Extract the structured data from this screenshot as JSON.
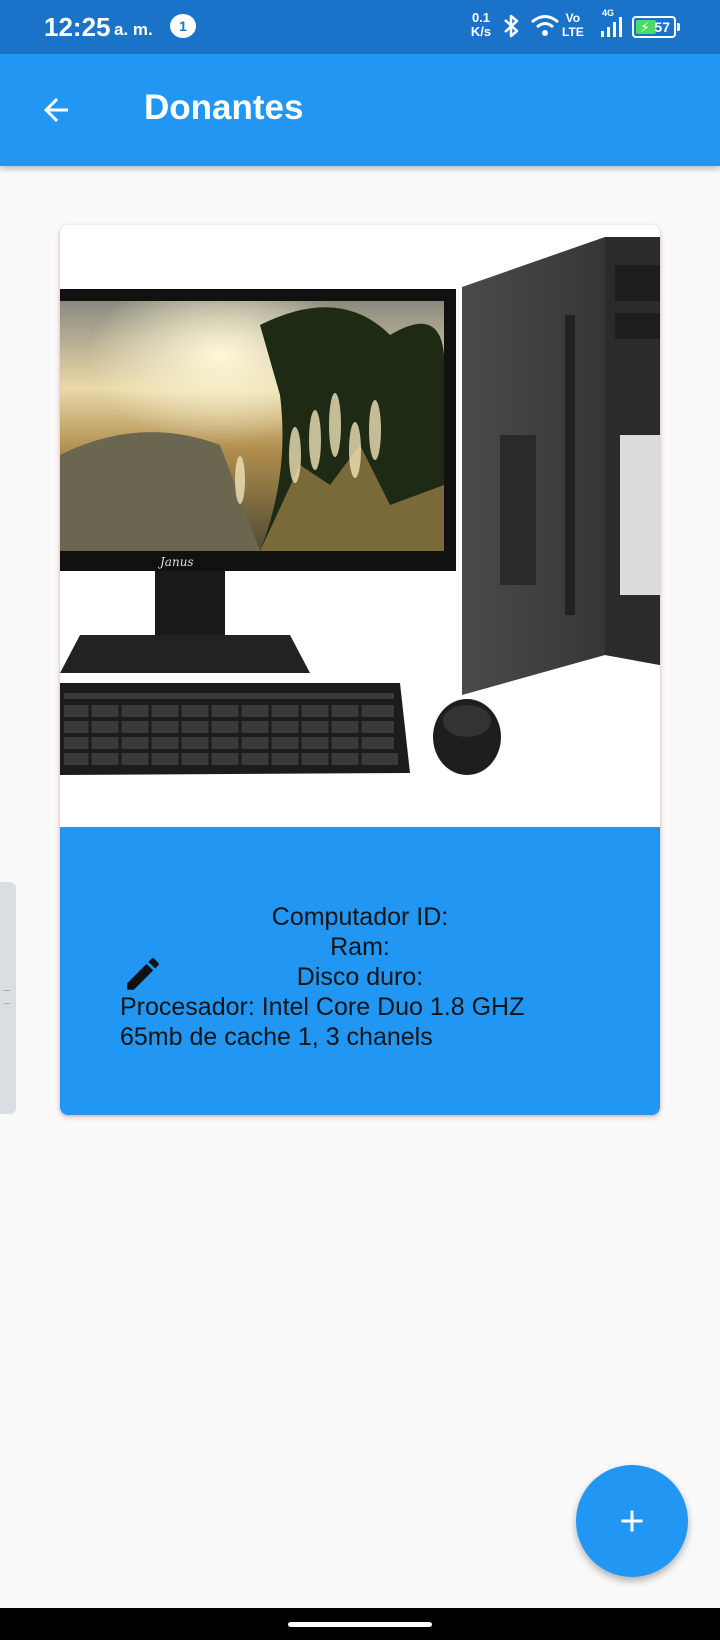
{
  "status_bar": {
    "time": "12:25",
    "ampm": "a. m.",
    "notification_count": "1",
    "speed_value": "0.1",
    "speed_unit": "K/s",
    "volte_top": "Vo",
    "volte_bottom": "LTE",
    "network": "4G",
    "battery": "57"
  },
  "app_bar": {
    "title": "Donantes",
    "back_icon": "arrow-back-icon"
  },
  "card": {
    "image": "desktop-computer-photo",
    "image_brand": "Janus",
    "fields": {
      "computer_id": "Computador ID:",
      "ram": "Ram:",
      "disk": "Disco duro:",
      "processor": "Procesador: Intel Core Duo 1.8 GHZ",
      "cache": "65mb de cache 1, 3 chanels"
    },
    "edit_icon": "pencil-icon"
  },
  "fab": {
    "icon": "plus-icon"
  },
  "colors": {
    "primary": "#2196f3",
    "status_bar": "#1b73c9",
    "background": "#fafafa",
    "battery_fill": "#4cd964"
  }
}
